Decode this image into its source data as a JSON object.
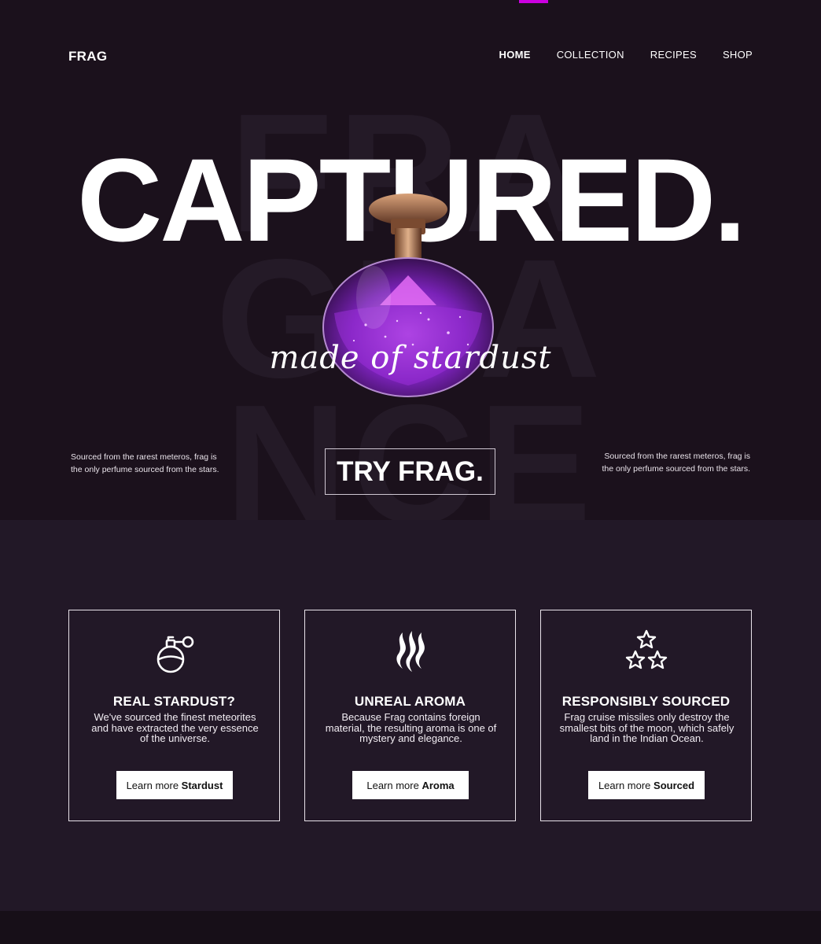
{
  "brand": "FRAG",
  "nav": {
    "items": [
      "HOME",
      "COLLECTION",
      "RECIPES",
      "SHOP"
    ],
    "active": "HOME"
  },
  "hero": {
    "background_word": [
      "FRA",
      "GRA",
      "NCE"
    ],
    "headline": "CAPTURED.",
    "tagline": "made of stardust",
    "side_note_left": "Sourced from the rarest meteros, frag is the only perfume sourced from the stars.",
    "side_note_right": "Sourced from the rarest meteros, frag is the only perfume sourced from the stars.",
    "cta": "TRY FRAG."
  },
  "features": [
    {
      "icon": "perfume-bottle-icon",
      "title": "REAL STARDUST?",
      "text": "We've sourced the finest meteorites and have extracted the very essence of the universe.",
      "button_prefix": "Learn more ",
      "button_bold": "Stardust"
    },
    {
      "icon": "aroma-waves-icon",
      "title": "UNREAL AROMA",
      "text": "Because Frag contains foreign material, the resulting aroma is one of mystery and elegance.",
      "button_prefix": "Learn more ",
      "button_bold": "Aroma"
    },
    {
      "icon": "three-stars-icon",
      "title": "RESPONSIBLY SOURCED",
      "text": "Frag cruise missiles only destroy the smallest bits of the moon, which safely land in the Indian Ocean.",
      "button_prefix": "Learn more ",
      "button_bold": "Sourced"
    }
  ],
  "colors": {
    "background": "#1b111c",
    "features_background": "#221827",
    "accent": "#cc00e0",
    "bottle_purple": "#8a2bc4"
  }
}
